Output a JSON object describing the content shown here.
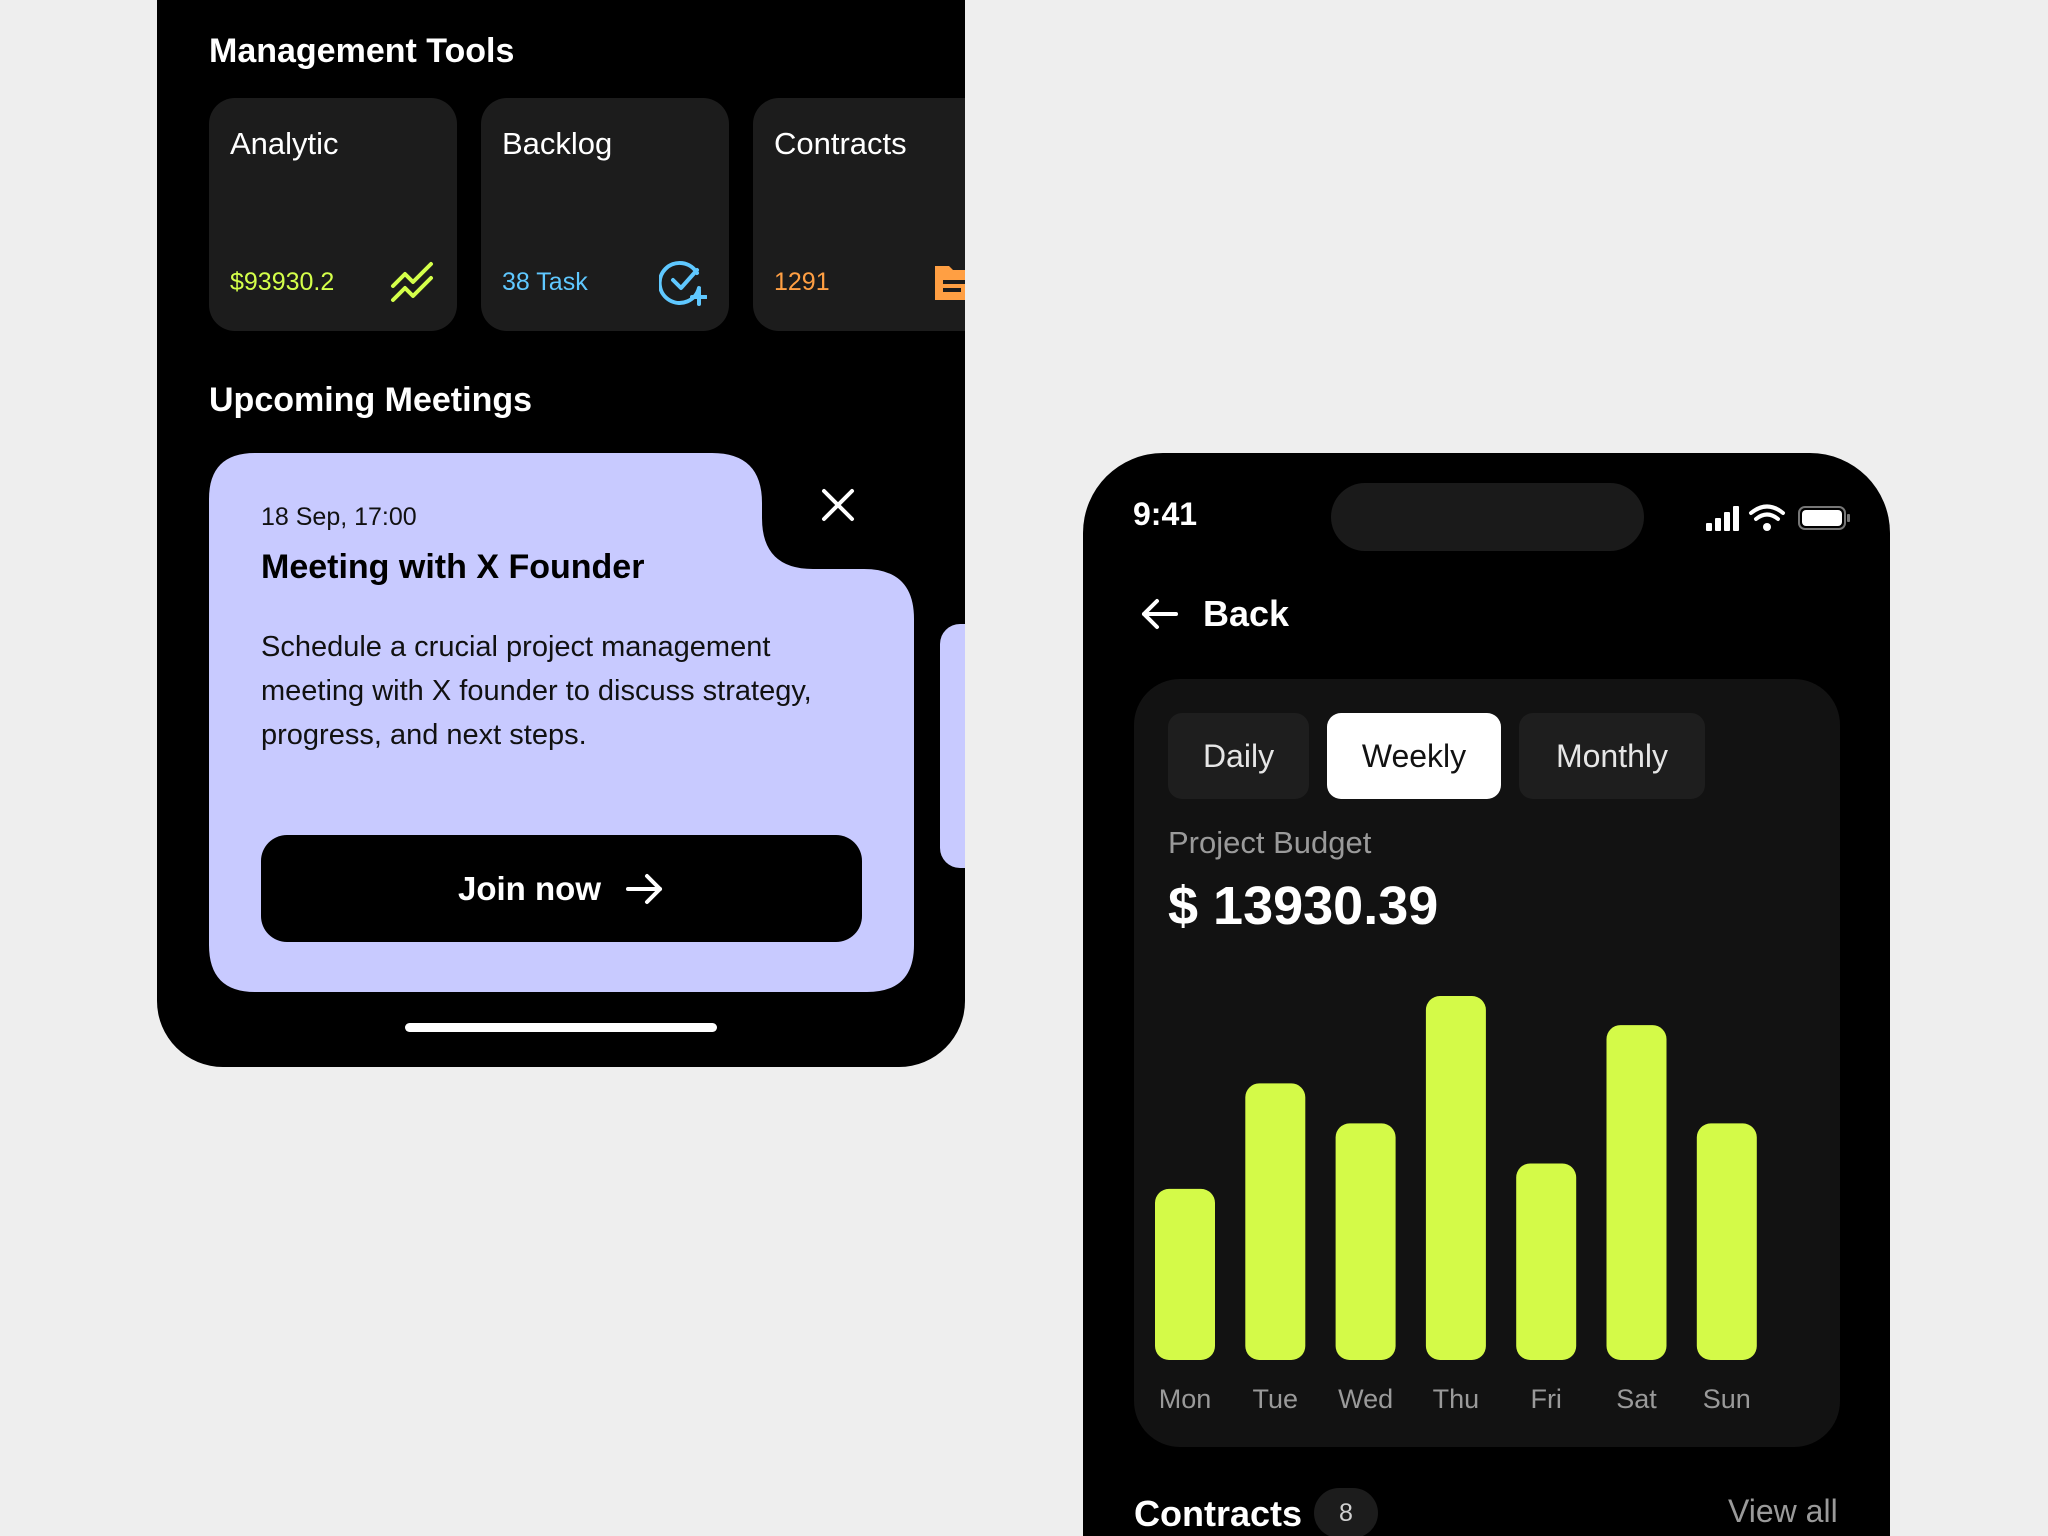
{
  "management": {
    "title": "Management Tools",
    "tools": [
      {
        "name": "Analytic",
        "value": "$93930.2",
        "color": "#d4ff4a",
        "icon": "trending-up-icon"
      },
      {
        "name": "Backlog",
        "value": "38 Task",
        "color": "#5fc8ff",
        "icon": "check-add-icon"
      },
      {
        "name": "Contracts",
        "value": "1291",
        "color": "#ff9f43",
        "icon": "folder-icon"
      }
    ]
  },
  "meetings": {
    "title": "Upcoming Meetings",
    "card": {
      "date": "18 Sep, 17:00",
      "title": "Meeting with X Founder",
      "description": "Schedule a crucial project management meeting with X founder to discuss strategy, progress, and next steps.",
      "join_label": "Join now",
      "background": "#c8caff"
    }
  },
  "status_bar": {
    "time": "9:41"
  },
  "nav": {
    "back_label": "Back"
  },
  "budget": {
    "tabs": [
      "Daily",
      "Weekly",
      "Monthly"
    ],
    "active_tab": "Weekly",
    "label": "Project Budget",
    "value": "$ 13930.39",
    "bar_color": "#d4fa48"
  },
  "chart_data": {
    "type": "bar",
    "categories": [
      "Mon",
      "Tue",
      "Wed",
      "Thu",
      "Fri",
      "Sat",
      "Sun"
    ],
    "values": [
      0.47,
      0.76,
      0.65,
      1.0,
      0.54,
      0.92,
      0.65
    ],
    "title": "",
    "xlabel": "",
    "ylabel": "",
    "grid": false
  },
  "contracts": {
    "title": "Contracts",
    "count": "8",
    "view_all": "View all"
  }
}
